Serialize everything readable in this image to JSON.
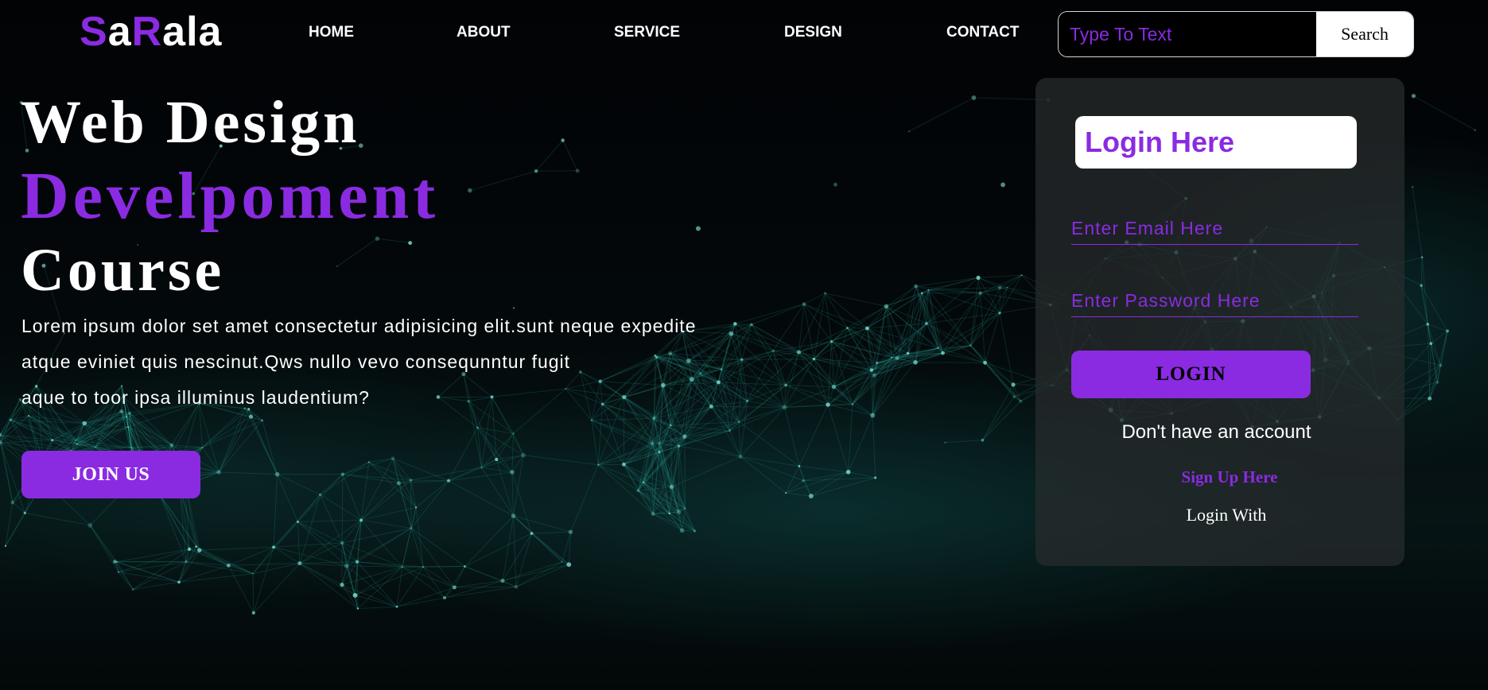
{
  "brand": {
    "logo_parts": [
      "S",
      "a",
      "R",
      "ala"
    ],
    "accent_color": "#8a2be2"
  },
  "nav": {
    "items": [
      "HOME",
      "ABOUT",
      "SERVICE",
      "DESIGN",
      "CONTACT"
    ]
  },
  "search": {
    "placeholder": "Type To Text",
    "button_label": "Search"
  },
  "hero": {
    "line1": "Web Design",
    "line2": "Develpoment",
    "line3": "Course",
    "paragraph_lines": [
      "Lorem ipsum dolor set amet consectetur adipisicing elit.sunt neque expedite",
      "atque eviniet quis nescinut.Qws nullo vevo consequnntur fugit",
      "aque to toor ipsa illuminus laudentium?"
    ],
    "cta_label": "JOIN US"
  },
  "login": {
    "title": "Login Here",
    "email_placeholder": "Enter Email Here",
    "password_placeholder": "Enter Password Here",
    "button_label": "LOGIN",
    "no_account_text": "Don't have an account",
    "signup_label": "Sign Up Here",
    "login_with_label": "Login With"
  },
  "colors": {
    "accent": "#8a2be2",
    "background": "#000000",
    "network_teal": "#2fb3a5"
  }
}
